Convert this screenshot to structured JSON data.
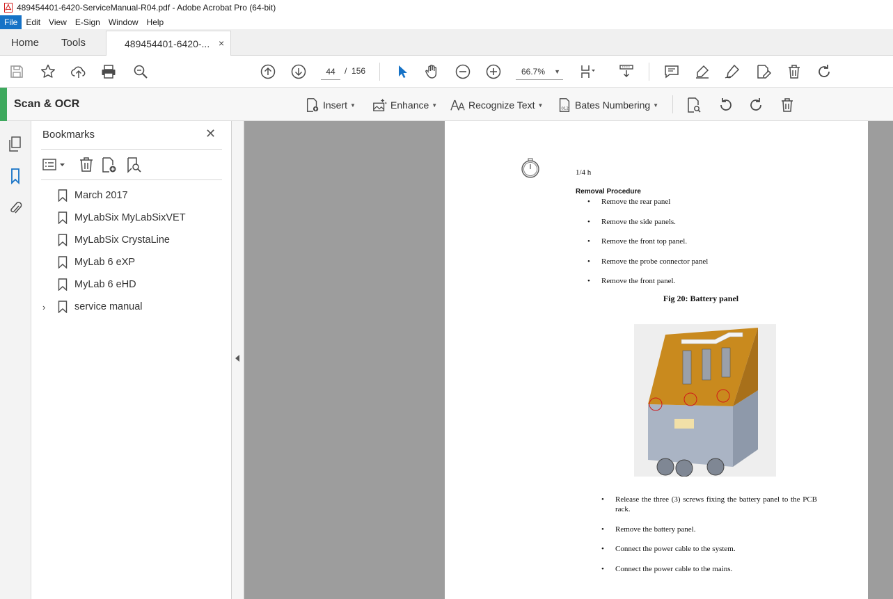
{
  "window": {
    "title": "489454401-6420-ServiceManual-R04.pdf - Adobe Acrobat Pro (64-bit)"
  },
  "menu": [
    "File",
    "Edit",
    "View",
    "E-Sign",
    "Window",
    "Help"
  ],
  "tabs": {
    "home": "Home",
    "tools": "Tools",
    "document": "489454401-6420-...",
    "close": "×"
  },
  "toolbar": {
    "page_current": "44",
    "page_separator": "/",
    "page_total": "156",
    "zoom": "66.7%"
  },
  "scan_ocr": {
    "title": "Scan & OCR",
    "insert": "Insert",
    "enhance": "Enhance",
    "recognize_text": "Recognize Text",
    "bates_numbering": "Bates Numbering",
    "accent_color": "#3ea95e"
  },
  "bookmarks": {
    "title": "Bookmarks",
    "close": "✕",
    "items": [
      {
        "label": "March 2017",
        "expandable": false
      },
      {
        "label": "MyLabSix MyLabSixVET",
        "expandable": false
      },
      {
        "label": "MyLabSix CrystaLine",
        "expandable": false
      },
      {
        "label": "MyLab 6 eXP",
        "expandable": false
      },
      {
        "label": "MyLab 6 eHD",
        "expandable": false
      },
      {
        "label": "service manual",
        "expandable": true
      }
    ]
  },
  "page": {
    "duration": "1/4 h",
    "procedure_title": "Removal Procedure",
    "steps_before": [
      "Remove the rear panel",
      "Remove the side panels.",
      "Remove the front top panel.",
      "Remove the probe connector panel",
      "Remove the front panel."
    ],
    "figure_caption": "Fig 20: Battery panel",
    "steps_after": [
      "Release the three (3) screws fixing the battery panel to the PCB rack.",
      "Remove the battery panel.",
      "Connect the power cable to the system.",
      "Connect the power cable to the mains."
    ],
    "bullet": "•"
  }
}
